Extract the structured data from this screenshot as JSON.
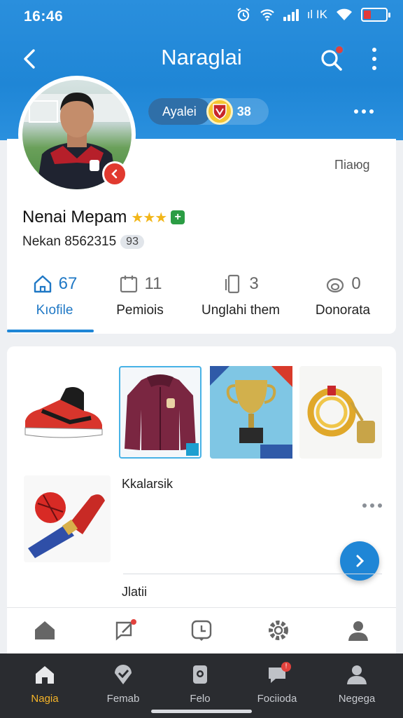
{
  "status": {
    "time": "16:46",
    "carrier": "ıl ΙΚ"
  },
  "nav": {
    "title": "Naraglai"
  },
  "header_pill": {
    "label": "Ayalei",
    "count": "38"
  },
  "profile": {
    "rank_tag": "Піаюg",
    "name": "Nenai Mepam",
    "stars": "★★★",
    "plus": "+",
    "sub_text": "Nekan 8562315",
    "sub_chip": "93"
  },
  "stats": [
    {
      "value": "67",
      "label": "Kıofile",
      "icon": "home-icon"
    },
    {
      "value": "11",
      "label": "Pemiois",
      "icon": "calendar-icon"
    },
    {
      "value": "3",
      "label": "Unglahi them",
      "icon": "phone-icon"
    },
    {
      "value": "0",
      "label": "Donorata",
      "icon": "ring-icon"
    }
  ],
  "sections": {
    "first": "Kkalarsik",
    "second": "Jlatii"
  },
  "bottom_tabs": [
    {
      "label": "Nagia",
      "icon": "home-icon"
    },
    {
      "label": "Femab",
      "icon": "pin-icon"
    },
    {
      "label": "Felo",
      "icon": "phone-icon"
    },
    {
      "label": "Fociioda",
      "icon": "chat-icon",
      "badge": "!"
    },
    {
      "label": "Negega",
      "icon": "user-icon"
    }
  ],
  "colors": {
    "primary": "#1f86d6",
    "accent": "#f5b428",
    "dark_bar": "#2a2c30"
  }
}
